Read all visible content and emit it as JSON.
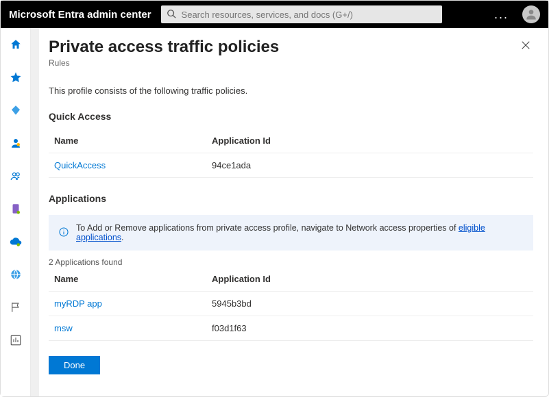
{
  "header": {
    "brand": "Microsoft Entra admin center",
    "search_placeholder": "Search resources, services, and docs (G+/)",
    "more_label": "..."
  },
  "rail": {
    "items": [
      {
        "name": "home-icon"
      },
      {
        "name": "star-icon"
      },
      {
        "name": "diamond-icon"
      },
      {
        "name": "person-icon"
      },
      {
        "name": "group-icon"
      },
      {
        "name": "device-icon"
      },
      {
        "name": "cloud-icon"
      },
      {
        "name": "globe-icon"
      },
      {
        "name": "flag-icon"
      },
      {
        "name": "chart-icon"
      }
    ]
  },
  "page": {
    "title": "Private access traffic policies",
    "subtitle": "Rules",
    "intro": "This profile consists of the following traffic policies."
  },
  "quick_access": {
    "heading": "Quick Access",
    "columns": {
      "name": "Name",
      "appid": "Application Id"
    },
    "rows": [
      {
        "name": "QuickAccess",
        "appid": "94ce1ada"
      }
    ]
  },
  "applications": {
    "heading": "Applications",
    "info_prefix": "To Add or Remove applications from private access profile, navigate to Network access properties of ",
    "info_link": "eligible applications",
    "info_suffix": ".",
    "count_text": "2 Applications found",
    "columns": {
      "name": "Name",
      "appid": "Application Id"
    },
    "rows": [
      {
        "name": "myRDP app",
        "appid": "5945b3bd"
      },
      {
        "name": "msw",
        "appid": "f03d1f63"
      }
    ]
  },
  "buttons": {
    "done": "Done"
  }
}
